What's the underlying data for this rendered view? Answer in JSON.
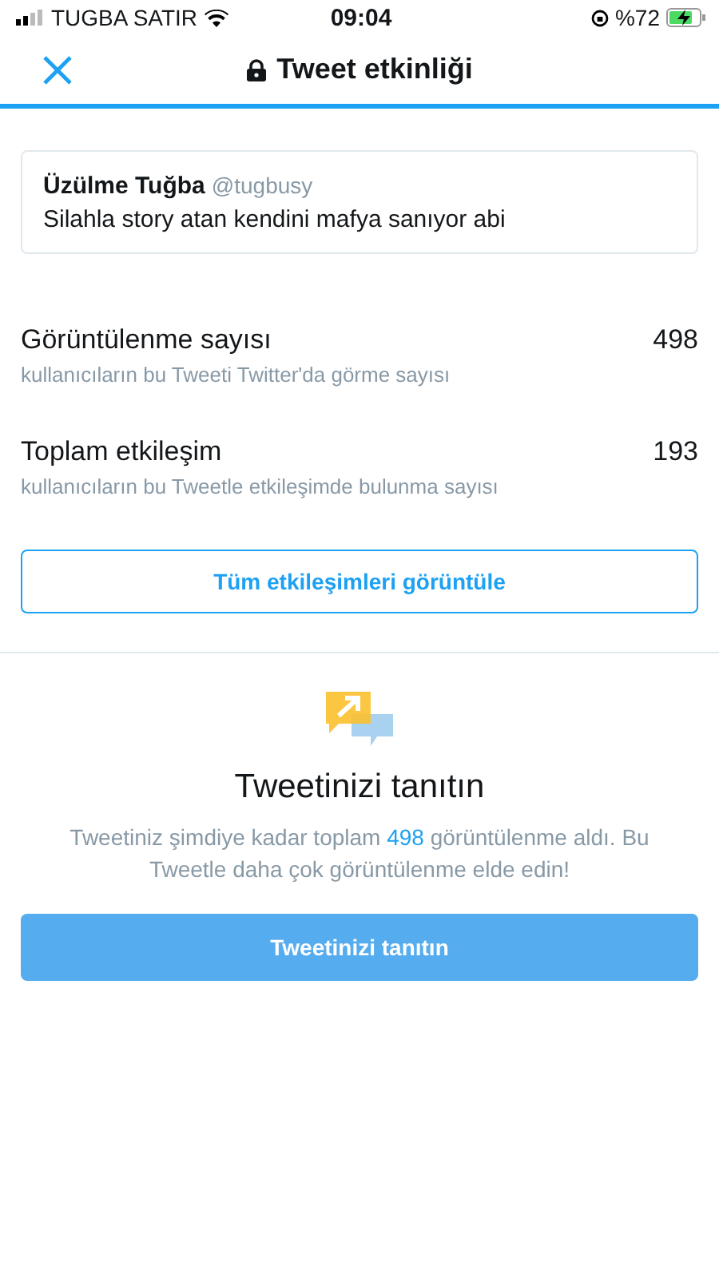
{
  "status_bar": {
    "carrier": "TUGBA SATIR",
    "time": "09:04",
    "battery": "%72"
  },
  "header": {
    "title": "Tweet etkinliği"
  },
  "tweet": {
    "name": "Üzülme Tuğba",
    "handle": "@tugbusy",
    "text": "Silahla story atan kendini mafya sanıyor abi"
  },
  "stats": [
    {
      "label": "Görüntülenme sayısı",
      "description": "kullanıcıların bu Tweeti Twitter'da görme sayısı",
      "value": "498"
    },
    {
      "label": "Toplam etkileşim",
      "description": "kullanıcıların bu Tweetle etkileşimde bulunma sayısı",
      "value": "193"
    }
  ],
  "view_all_button": "Tüm etkileşimleri görüntüle",
  "promote": {
    "title": "Tweetinizi tanıtın",
    "text_before": "Tweetiniz şimdiye kadar toplam ",
    "count": "498",
    "text_after": " görüntülenme aldı. Bu Tweetle daha çok görüntülenme elde edin!",
    "button": "Tweetinizi tanıtın"
  }
}
